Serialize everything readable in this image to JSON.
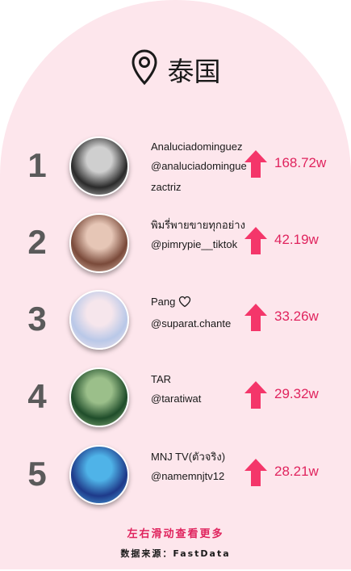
{
  "header": {
    "title": "泰国",
    "icon": "location-pin-icon"
  },
  "colors": {
    "accent": "#e0245e",
    "arrow": "#f4366a",
    "background": "#fde6ec",
    "rank": "#5a5a5a"
  },
  "rows": [
    {
      "rank": "1",
      "name": "Analuciadominguez",
      "handle": "@analuciadominguezactriz",
      "value": "168.72w",
      "avatar_colors": [
        "#2a2a2a",
        "#cfcfcf"
      ]
    },
    {
      "rank": "2",
      "name": "พิมรี่พายขายทุกอย่าง",
      "handle": "@pimrypie__tiktok",
      "value": "42.19w",
      "avatar_colors": [
        "#7a4a3a",
        "#e6c6b6"
      ]
    },
    {
      "rank": "3",
      "name": "Pang",
      "name_icon": "heart-outline-icon",
      "handle": "@suparat.chante",
      "value": "33.26w",
      "avatar_colors": [
        "#b9c8e8",
        "#f6e6ec"
      ]
    },
    {
      "rank": "4",
      "name": "TAR",
      "handle": "@taratiwat",
      "value": "29.32w",
      "avatar_colors": [
        "#1f4d2a",
        "#9bbf8a"
      ]
    },
    {
      "rank": "5",
      "name": "MNJ TV(ตัวจริง)",
      "handle": "@namemnjtv12",
      "value": "28.21w",
      "avatar_colors": [
        "#1e3a8a",
        "#4fb3e8"
      ]
    }
  ],
  "footer": {
    "hint": "左右滑动查看更多",
    "source": "数据来源：FastData"
  }
}
